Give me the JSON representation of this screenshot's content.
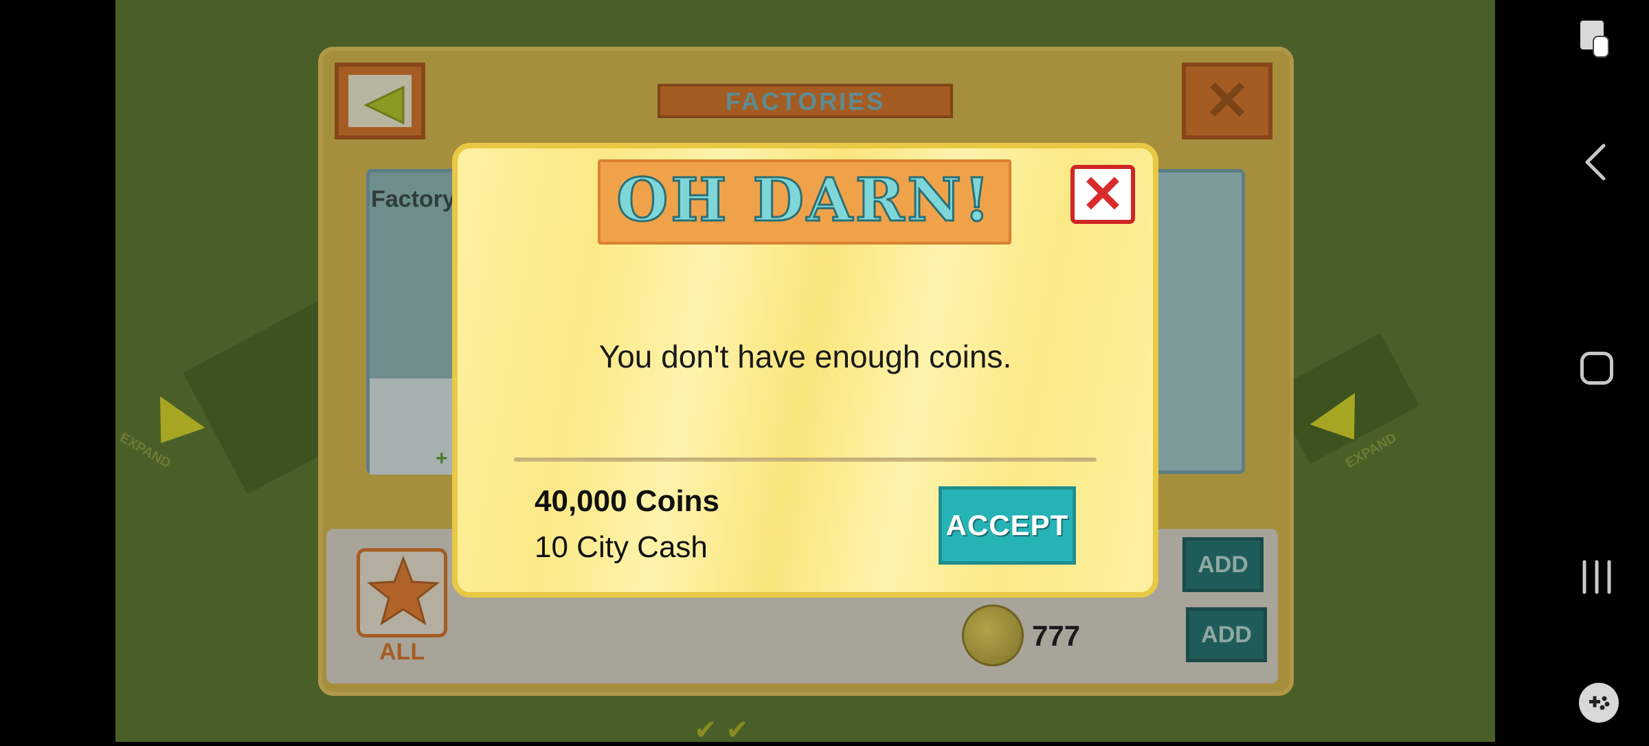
{
  "panel": {
    "title": "FACTORIES",
    "card_label": "Factory",
    "card_plus": "+",
    "all_label": "ALL",
    "coin_count": "777",
    "add_label_1": "ADD",
    "add_label_2": "ADD",
    "expand_left": "EXPAND",
    "expand_right": "EXPAND"
  },
  "modal": {
    "title": "OH DARN!",
    "message": "You don't have enough coins.",
    "price_coins": "40,000 Coins",
    "price_cash": "10 City Cash",
    "accept_label": "ACCEPT"
  },
  "colors": {
    "modal_bg": "#fdf1a2",
    "accept": "#26b3b6",
    "close_red": "#d02626",
    "title_orange": "#f0a24a"
  },
  "icons": [
    "back-arrow-icon",
    "close-icon",
    "star-icon",
    "coin-icon",
    "edit-overlay-icon",
    "nav-back-icon",
    "nav-home-icon",
    "nav-recents-icon",
    "game-tools-icon"
  ]
}
